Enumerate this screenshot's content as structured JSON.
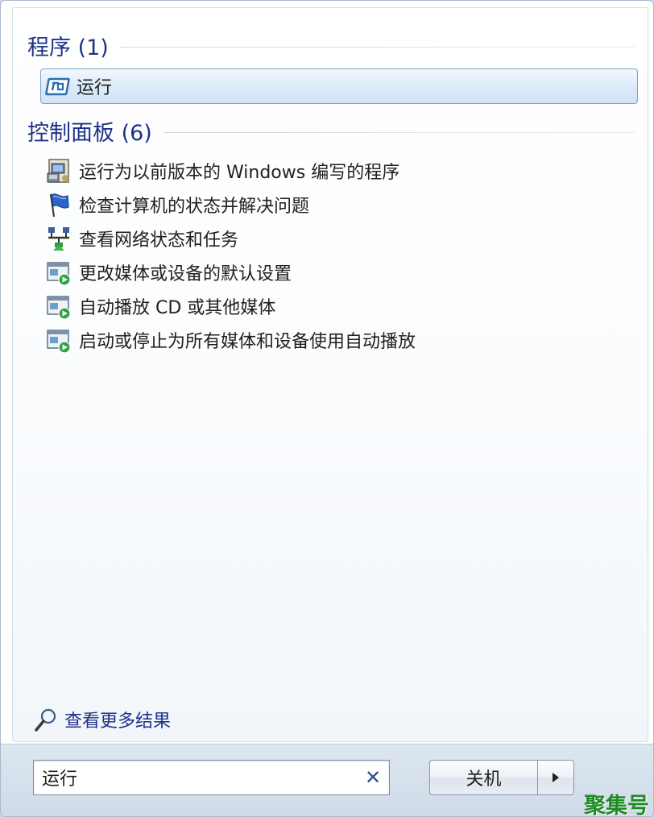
{
  "groups": [
    {
      "title": "程序 (1)",
      "items": [
        {
          "label": "运行",
          "icon": "run-icon",
          "selected": true
        }
      ]
    },
    {
      "title": "控制面板 (6)",
      "items": [
        {
          "label": "运行为以前版本的 Windows 编写的程序",
          "icon": "compatibility-icon"
        },
        {
          "label": "检查计算机的状态并解决问题",
          "icon": "action-center-flag-icon"
        },
        {
          "label": "查看网络状态和任务",
          "icon": "network-icon"
        },
        {
          "label": "更改媒体或设备的默认设置",
          "icon": "autoplay-icon"
        },
        {
          "label": "自动播放 CD 或其他媒体",
          "icon": "autoplay-icon"
        },
        {
          "label": "启动或停止为所有媒体和设备使用自动播放",
          "icon": "autoplay-icon"
        }
      ]
    }
  ],
  "see_more": {
    "label": "查看更多结果",
    "icon": "magnifier-icon"
  },
  "search": {
    "value": "运行",
    "clear_icon": "close-icon"
  },
  "shutdown": {
    "label": "关机",
    "arrow_icon": "triangle-right-icon"
  },
  "watermark": "聚集号",
  "colors": {
    "header_text": "#1e3287",
    "selection_border": "#7da2ce",
    "watermark": "#1f8a26"
  }
}
